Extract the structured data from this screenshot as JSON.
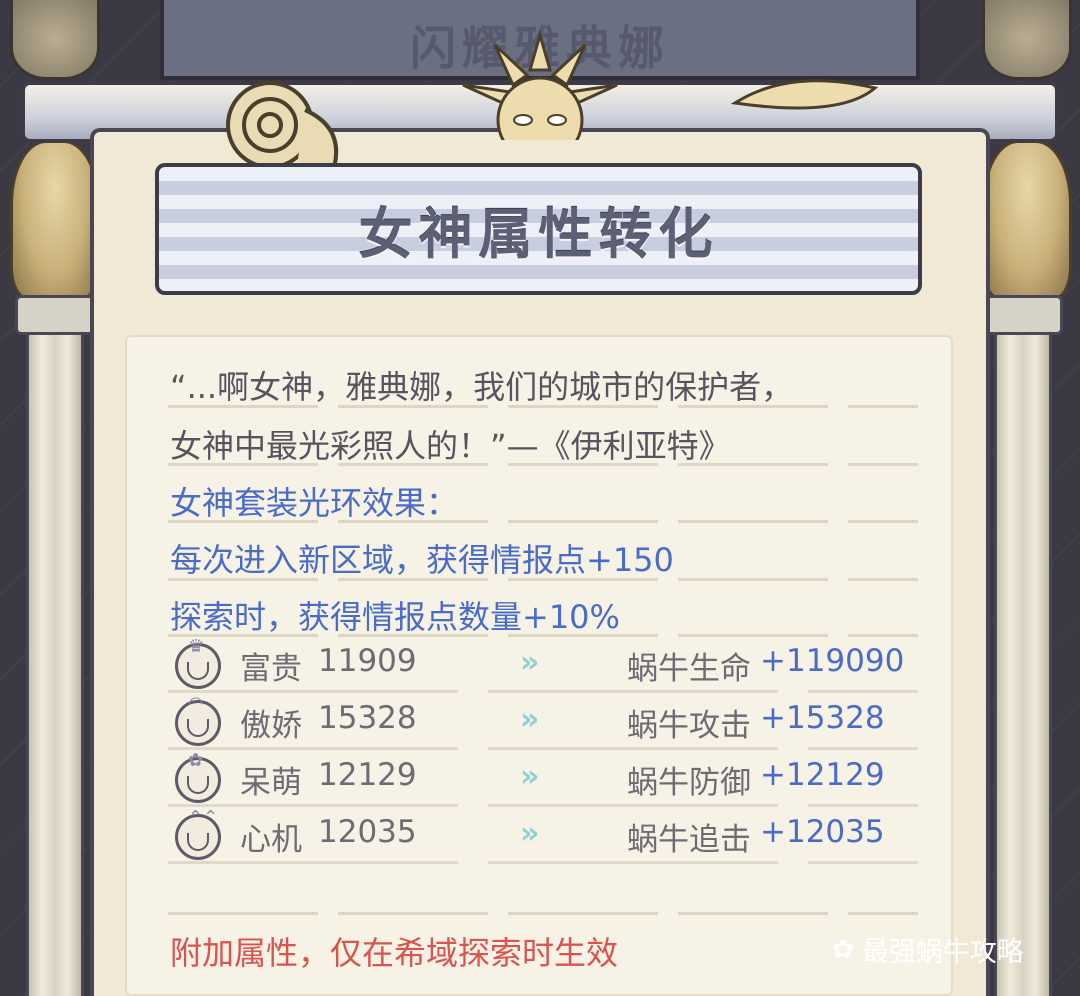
{
  "header": {
    "top_banner": "闪耀雅典娜",
    "title": "女神属性转化"
  },
  "quote": {
    "line1": "“...啊女神，雅典娜，我们的城市的保护者，",
    "line2": "女神中最光彩照人的！”—《伊利亚特》"
  },
  "set_effect": {
    "heading": "女神套装光环效果：",
    "effect1": "每次进入新区域，获得情报点+150",
    "effect2": "探索时，获得情报点数量+10%"
  },
  "conversions": [
    {
      "icon": "crown-face-icon",
      "name": "富贵",
      "value": "11909",
      "stat": "蜗牛生命",
      "bonus": "+119090"
    },
    {
      "icon": "halo-face-icon",
      "name": "傲娇",
      "value": "15328",
      "stat": "蜗牛攻击",
      "bonus": "+15328"
    },
    {
      "icon": "cute-face-icon",
      "name": "呆萌",
      "value": "12129",
      "stat": "蜗牛防御",
      "bonus": "+12129"
    },
    {
      "icon": "horn-face-icon",
      "name": "心机",
      "value": "12035",
      "stat": "蜗牛追击",
      "bonus": "+12035"
    }
  ],
  "arrow_glyph": "»",
  "footer_note": "附加属性，仅在希域探索时生效",
  "watermark": "最强蜗牛攻略",
  "colors": {
    "blue_text": "#4a6bc6",
    "red_text": "#d9534f",
    "arrow": "#8fd1d1",
    "parchment": "#f1e9d6"
  }
}
